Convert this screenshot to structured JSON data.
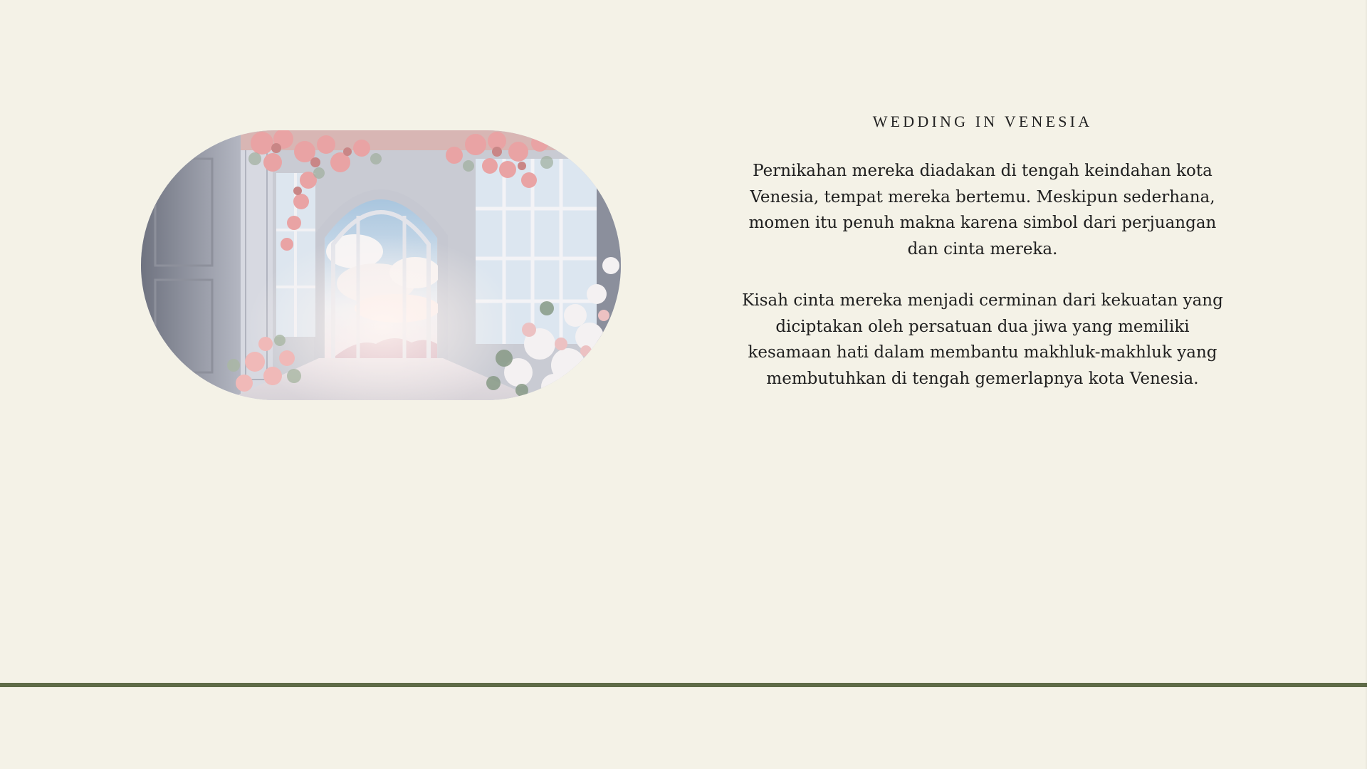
{
  "slide": {
    "title": "WEDDING IN VENESIA",
    "paragraphs": [
      "Pernikahan mereka diadakan di tengah keindahan kota Venesia, tempat mereka bertemu. Meskipun sederhana, momen itu penuh makna karena simbol dari perjuangan dan cinta mereka.",
      "Kisah cinta mereka menjadi cerminan dari kekuatan yang diciptakan oleh persatuan dua jiwa yang memiliki kesamaan hati dalam membantu makhluk-makhluk yang membutuhkan di tengah gemerlapnya kota Venesia."
    ]
  },
  "colors": {
    "background": "#f4f2e7",
    "divider": "#5f6b47",
    "text": "#202020"
  }
}
